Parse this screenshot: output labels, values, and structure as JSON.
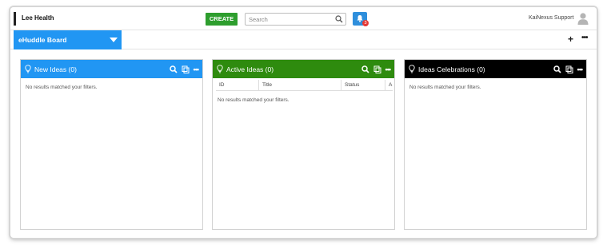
{
  "header": {
    "org_name": "Lee Health",
    "create_label": "CREATE",
    "search_placeholder": "Search",
    "notification_count": "3",
    "user_name": "KaiNexus Support"
  },
  "board": {
    "name": "eHuddle Board",
    "add_label": "+",
    "more_label": "•••"
  },
  "panels": [
    {
      "title": "New Ideas (0)",
      "color": "#2196f3",
      "empty_text": "No results matched your filters."
    },
    {
      "title": "Active Ideas (0)",
      "color": "#2e8b0e",
      "columns": [
        "ID",
        "Title",
        "Status",
        "A"
      ],
      "empty_text": "No results matched your filters."
    },
    {
      "title": "Ideas Celebrations (0)",
      "color": "#000000",
      "empty_text": "No results matched your filters."
    }
  ],
  "icons": {
    "bulb": "bulb-icon",
    "search": "search-icon",
    "copy": "copy-icon",
    "more": "more-icon",
    "bell": "bell-icon",
    "avatar": "avatar-icon"
  },
  "panel_more_label": "•••"
}
